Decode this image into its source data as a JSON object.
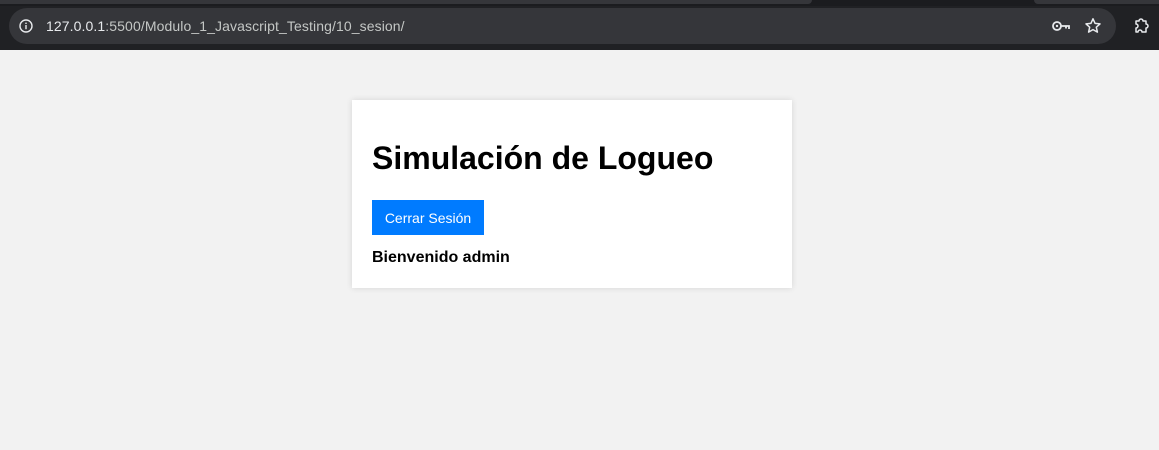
{
  "browser": {
    "url_host": "127.0.0.1",
    "url_path": ":5500/Modulo_1_Javascript_Testing/10_sesion/",
    "icons": {
      "site_info": "info-icon",
      "password": "key-icon",
      "bookmark": "star-icon",
      "extensions": "puzzle-icon"
    }
  },
  "page": {
    "title": "Simulación de Logueo",
    "logout_label": "Cerrar Sesión",
    "welcome": "Bienvenido admin"
  },
  "colors": {
    "page_background": "#f2f2f2",
    "card_background": "#ffffff",
    "button_background": "#007bff",
    "chrome_background": "#202124"
  }
}
